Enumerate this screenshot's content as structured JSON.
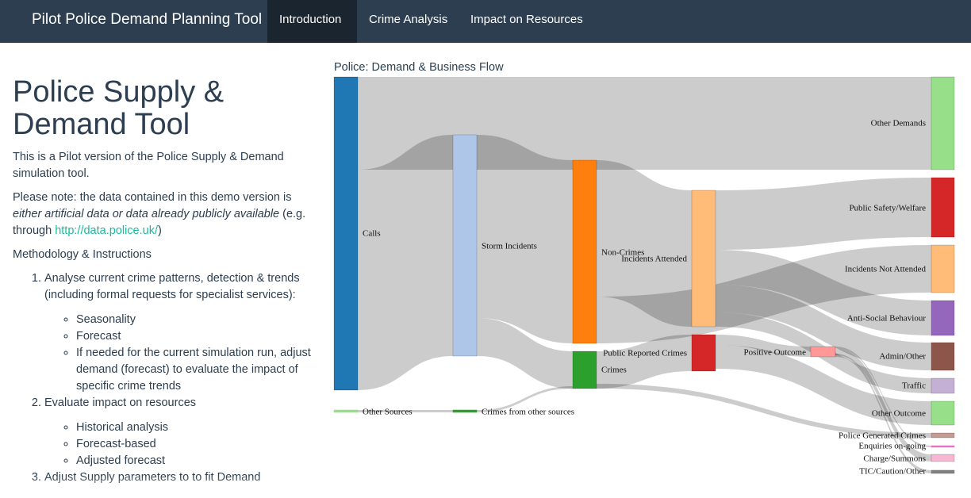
{
  "navbar": {
    "brand": "Pilot Police Demand Planning Tool",
    "tabs": [
      {
        "label": "Introduction",
        "active": true
      },
      {
        "label": "Crime Analysis",
        "active": false
      },
      {
        "label": "Impact on Resources",
        "active": false
      }
    ]
  },
  "intro": {
    "title": "Police Supply & Demand Tool",
    "description": "This is a Pilot version of the Police Supply & Demand simulation tool.",
    "note_prefix": "Please note: the data contained in this demo version is ",
    "note_emphasis": "either artificial data or data already publicly available",
    "note_mid": " (e.g. through ",
    "note_link": "http://data.police.uk/",
    "note_suffix": ")",
    "methodology_heading": "Methodology & Instructions",
    "steps": [
      {
        "text": "Analyse current crime patterns, detection & trends (including formal requests for specialist services):",
        "sub": [
          "Seasonality",
          "Forecast",
          "If needed for the current simulation run, adjust demand (forecast) to evaluate the impact of specific crime trends"
        ]
      },
      {
        "text": "Evaluate impact on resources",
        "sub": [
          "Historical analysis",
          "Forecast-based",
          "Adjusted forecast"
        ]
      },
      {
        "text": "Adjust Supply parameters to to fit Demand",
        "sub": []
      }
    ]
  },
  "sankey": {
    "title": "Police: Demand & Business Flow",
    "nodes": [
      {
        "id": "calls",
        "label": "Calls",
        "color": "#1f77b4"
      },
      {
        "id": "other_sources",
        "label": "Other Sources",
        "color": "#98df8a"
      },
      {
        "id": "storm",
        "label": "Storm Incidents",
        "color": "#aec7e8"
      },
      {
        "id": "crimes_other",
        "label": "Crimes from other sources",
        "color": "#2ca02c"
      },
      {
        "id": "noncrimes",
        "label": "Non-Crimes",
        "color": "#ff7f0e"
      },
      {
        "id": "crimes",
        "label": "Crimes",
        "color": "#2ca02c"
      },
      {
        "id": "attended",
        "label": "Incidents Attended",
        "color": "#ffbb78"
      },
      {
        "id": "public_reported",
        "label": "Public Reported Crimes",
        "color": "#d62728"
      },
      {
        "id": "positive",
        "label": "Positive Outcome",
        "color": "#ff9896"
      },
      {
        "id": "other_demands",
        "label": "Other Demands",
        "color": "#98df8a"
      },
      {
        "id": "public_safety",
        "label": "Public Safety/Welfare",
        "color": "#d62728"
      },
      {
        "id": "not_attended",
        "label": "Incidents Not Attended",
        "color": "#ffbb78"
      },
      {
        "id": "asb",
        "label": "Anti-Social Behaviour",
        "color": "#9467bd"
      },
      {
        "id": "admin",
        "label": "Admin/Other",
        "color": "#8c564b"
      },
      {
        "id": "traffic",
        "label": "Traffic",
        "color": "#c5b0d5"
      },
      {
        "id": "other_outcome",
        "label": "Other Outcome",
        "color": "#98df8a"
      },
      {
        "id": "police_generated",
        "label": "Police Generated Crimes",
        "color": "#c49c94"
      },
      {
        "id": "enquiries",
        "label": "Enquiries on-going",
        "color": "#e377c2"
      },
      {
        "id": "charge",
        "label": "Charge/Summons",
        "color": "#f7b6d2"
      },
      {
        "id": "tic",
        "label": "TIC/Caution/Other",
        "color": "#7f7f7f"
      }
    ]
  }
}
